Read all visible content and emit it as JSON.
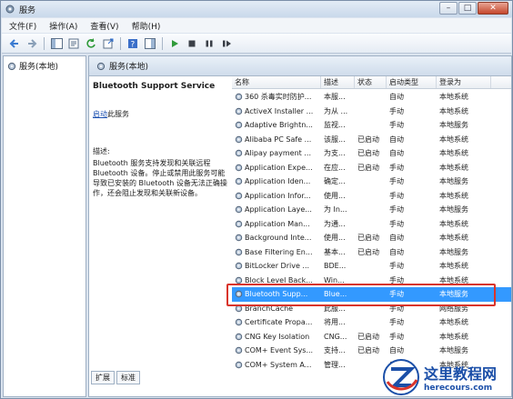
{
  "window": {
    "title": "服务"
  },
  "menu": [
    "文件(F)",
    "操作(A)",
    "查看(V)",
    "帮助(H)"
  ],
  "tree": {
    "root": "服务(本地)"
  },
  "header": {
    "title": "服务(本地)"
  },
  "detail": {
    "service_name": "Bluetooth Support Service",
    "start_link": "启动",
    "start_suffix": "此服务",
    "desc_label": "描述:",
    "desc_text": "Bluetooth 服务支持发现和关联远程 Bluetooth 设备。停止或禁用此服务可能导致已安装的 Bluetooth 设备无法正确操作，还会阻止发现和关联新设备。"
  },
  "tabs": [
    "扩展",
    "标准"
  ],
  "columns": [
    "名称",
    "描述",
    "状态",
    "启动类型",
    "登录为"
  ],
  "rows": [
    [
      "360 杀毒实时防护...",
      "本服...",
      "",
      "自动",
      "本地系统"
    ],
    [
      "ActiveX Installer ...",
      "为从 ...",
      "",
      "手动",
      "本地系统"
    ],
    [
      "Adaptive Brightn...",
      "监视...",
      "",
      "手动",
      "本地服务"
    ],
    [
      "Alibaba PC Safe ...",
      "该服...",
      "已启动",
      "自动",
      "本地系统"
    ],
    [
      "Alipay payment ...",
      "为支...",
      "已启动",
      "自动",
      "本地系统"
    ],
    [
      "Application Expe...",
      "在应...",
      "已启动",
      "手动",
      "本地系统"
    ],
    [
      "Application Iden...",
      "确定...",
      "",
      "手动",
      "本地服务"
    ],
    [
      "Application Infor...",
      "使用...",
      "",
      "手动",
      "本地系统"
    ],
    [
      "Application Laye...",
      "为 In...",
      "",
      "手动",
      "本地服务"
    ],
    [
      "Application Man...",
      "为通...",
      "",
      "手动",
      "本地系统"
    ],
    [
      "Background Inte...",
      "使用...",
      "已启动",
      "自动",
      "本地系统"
    ],
    [
      "Base Filtering En...",
      "基本...",
      "已启动",
      "自动",
      "本地服务"
    ],
    [
      "BitLocker Drive ...",
      "BDE...",
      "",
      "手动",
      "本地系统"
    ],
    [
      "Block Level Back...",
      "Win...",
      "",
      "手动",
      "本地系统"
    ],
    [
      "Bluetooth Supp...",
      "Blue...",
      "",
      "手动",
      "本地服务"
    ],
    [
      "BranchCache",
      "此服...",
      "",
      "手动",
      "网络服务"
    ],
    [
      "Certificate Propa...",
      "将用...",
      "",
      "手动",
      "本地系统"
    ],
    [
      "CNG Key Isolation",
      "CNG...",
      "已启动",
      "手动",
      "本地系统"
    ],
    [
      "COM+ Event Sys...",
      "支持...",
      "已启动",
      "自动",
      "本地服务"
    ],
    [
      "COM+ System A...",
      "管理...",
      "",
      "手动",
      "本地系统"
    ]
  ],
  "selected_row_index": 14,
  "watermark": {
    "title": "这里教程网",
    "url": "herecours.com"
  },
  "colors": {
    "selection": "#3399ff",
    "highlight_box": "#d9342b",
    "link": "#1a4fb0",
    "watermark": "#1b4fa8"
  }
}
